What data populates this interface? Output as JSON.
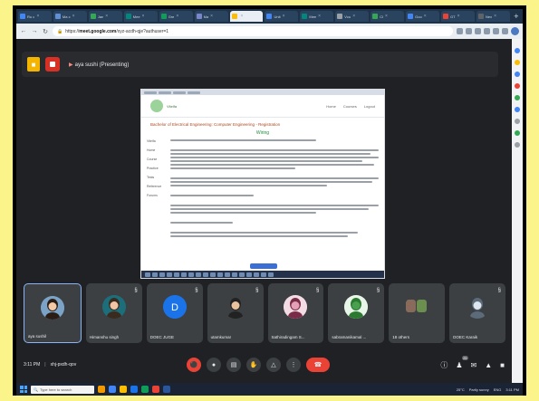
{
  "browser": {
    "tabs": [
      {
        "label": "Ru o",
        "color": "#4285f4"
      },
      {
        "label": "Ma c",
        "color": "#5f8fd6"
      },
      {
        "label": "Jan",
        "color": "#34a853"
      },
      {
        "label": "Mee",
        "color": "#00897b"
      },
      {
        "label": "Gre",
        "color": "#0f9d58"
      },
      {
        "label": "Ma",
        "color": "#7986cb"
      },
      {
        "label": "",
        "color": "#fbbc04",
        "active": true
      },
      {
        "label": "Unit",
        "color": "#4285f4"
      },
      {
        "label": "Mee",
        "color": "#00897b"
      },
      {
        "label": "Vcu",
        "color": "#9aa0a6"
      },
      {
        "label": "Cl",
        "color": "#34a853"
      },
      {
        "label": "Goo",
        "color": "#4285f4"
      },
      {
        "label": "GT",
        "color": "#ea4335"
      },
      {
        "label": "Nex",
        "color": "#5f6368"
      }
    ],
    "new_tab_label": "+",
    "url_host": "meet.google.com",
    "url_prefix": "https://",
    "url_path": "/xyz-acdh-qje?authuser=1"
  },
  "meet": {
    "presenting_label": "aya sushi (Presenting)",
    "shared_screen": {
      "logo_text": "Vitelfa",
      "header_buttons": [
        "Home",
        "Courses",
        "Logout"
      ],
      "course_title": "Bachelor of Electrical Engineering: Computer Engineering - Registration",
      "section_title": "Wiring",
      "left_nav": [
        "Vitelfa",
        "Home",
        "Course",
        "Practice",
        "Tests",
        "Reference",
        "Forums"
      ]
    },
    "participants": [
      {
        "name": "aya sushil",
        "self": true,
        "muted": false,
        "avatar_color": "#f2c9a6",
        "hair": "#2b1d14",
        "bg": "#7aa3c7"
      },
      {
        "name": "Himanshu singh",
        "muted": true,
        "avatar_color": "#f0c4a4",
        "hair": "#3b2a1e",
        "bg": "#1c6e7a"
      },
      {
        "name": "DOEC JUGE",
        "muted": true,
        "avatar_color": "#1a73e8",
        "hair": "#1a73e8",
        "bg": "#1a73e8",
        "initial": "D"
      },
      {
        "name": "utamkumar",
        "muted": true,
        "avatar_color": "#e9c19c",
        "hair": "#222",
        "bg": "#3c4043"
      },
      {
        "name": "Sathiradingam S...",
        "muted": true,
        "avatar_color": "#e4a0b6",
        "hair": "#7a2d48",
        "bg": "#f3dce3"
      },
      {
        "name": "sabramanikamal ...",
        "muted": true,
        "avatar_color": "#49a04e",
        "hair": "#2b7a30",
        "bg": "#e8f5e9"
      },
      {
        "name": "18 others",
        "muted": false,
        "avatar_color": "#6b8f4e",
        "hair": "#3c5a2a",
        "bg": "#3c4043",
        "group": true
      },
      {
        "name": "DOEC Karaik",
        "muted": true,
        "avatar_color": "#dfe6ee",
        "hair": "#5b6b7a",
        "bg": "#3c4043"
      }
    ],
    "meeting_time": "3:11 PM",
    "meeting_code": "xhj-pxdh-qov",
    "controls": [
      "mic",
      "cam",
      "cc",
      "hand",
      "present",
      "more"
    ],
    "people_count": "25"
  },
  "taskbar": {
    "search_placeholder": "Type here to search",
    "tray_weather": "25°C",
    "tray_weather_desc": "Partly sunny",
    "tray_lang": "ENG",
    "tray_time": "3:11 PM"
  },
  "colors": {
    "border": "#fbf48a",
    "meet_bg": "#202124",
    "tile_bg": "#3c4043",
    "end_call": "#ea4335",
    "accent": "#8ab4f8"
  }
}
